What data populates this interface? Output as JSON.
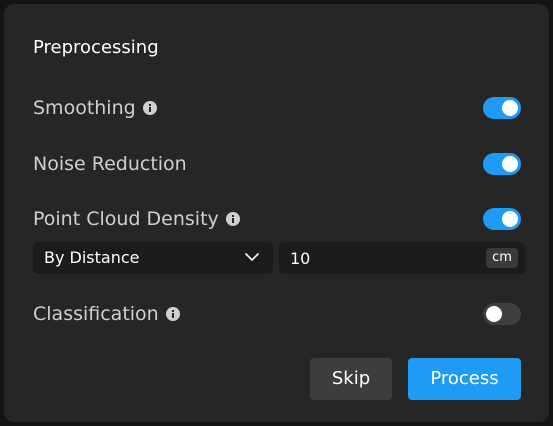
{
  "dialog": {
    "title": "Preprocessing"
  },
  "rows": {
    "smoothing": {
      "label": "Smoothing",
      "has_info": true,
      "enabled": true
    },
    "noise_reduction": {
      "label": "Noise Reduction",
      "has_info": false,
      "enabled": true
    },
    "point_cloud_density": {
      "label": "Point Cloud Density",
      "has_info": true,
      "enabled": true
    },
    "classification": {
      "label": "Classification",
      "has_info": true,
      "enabled": false
    }
  },
  "density": {
    "mode_selected": "By Distance",
    "value": "10",
    "unit": "cm"
  },
  "buttons": {
    "skip_label": "Skip",
    "process_label": "Process"
  },
  "icons": {
    "info": "info-icon",
    "dropdown": "chevron-down-icon"
  },
  "colors": {
    "accent": "#1e9bf5",
    "panel_bg": "#262626",
    "toggle_off": "#3f3f3f"
  }
}
